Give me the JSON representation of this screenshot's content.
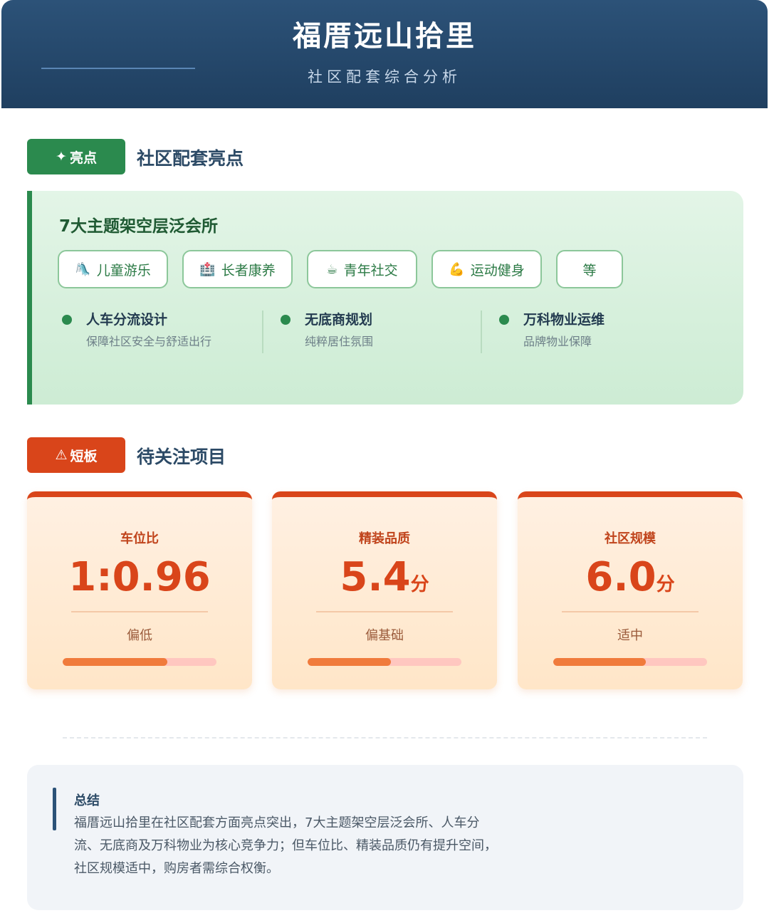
{
  "header": {
    "title": "福厝远山拾里",
    "subtitle": "社区配套综合分析"
  },
  "highlights": {
    "tag_icon": "sparkle-icon",
    "tag_label": "亮点",
    "title": "社区配套亮点",
    "card_title": "7大主题架空层泛会所",
    "chips": [
      {
        "icon": "child-play-icon",
        "label": "儿童游乐"
      },
      {
        "icon": "elder-care-icon",
        "label": "长者康养"
      },
      {
        "icon": "youth-social-icon",
        "label": "青年社交"
      },
      {
        "icon": "muscle-icon",
        "label": "运动健身"
      },
      {
        "icon": "",
        "label": "等"
      }
    ],
    "features": [
      {
        "title": "人车分流设计",
        "desc": "保障社区安全与舒适出行"
      },
      {
        "title": "无底商规划",
        "desc": "纯粹居住氛围"
      },
      {
        "title": "万科物业运维",
        "desc": "品牌物业保障"
      }
    ]
  },
  "shortcomings": {
    "tag_icon": "warning-icon",
    "tag_label": "短板",
    "title": "待关注项目",
    "metrics": [
      {
        "label": "车位比",
        "value": "1:0.96",
        "unit": "",
        "status": "偏低",
        "progress": 0.68
      },
      {
        "label": "精装品质",
        "value": "5.4",
        "unit": "分",
        "status": "偏基础",
        "progress": 0.54
      },
      {
        "label": "社区规模",
        "value": "6.0",
        "unit": "分",
        "status": "适中",
        "progress": 0.6
      }
    ]
  },
  "summary": {
    "title": "总结",
    "text": "福厝远山拾里在社区配套方面亮点突出，7大主题架空层泛会所、人车分流、无底商及万科物业为核心竞争力；但车位比、精装品质仍有提升空间，社区规模适中，购房者需综合权衡。"
  },
  "colors": {
    "header_bg": "#2c5278",
    "highlight_green": "#2b8a4e",
    "warning_red": "#d9451a",
    "progress_orange": "#f07b3c"
  }
}
